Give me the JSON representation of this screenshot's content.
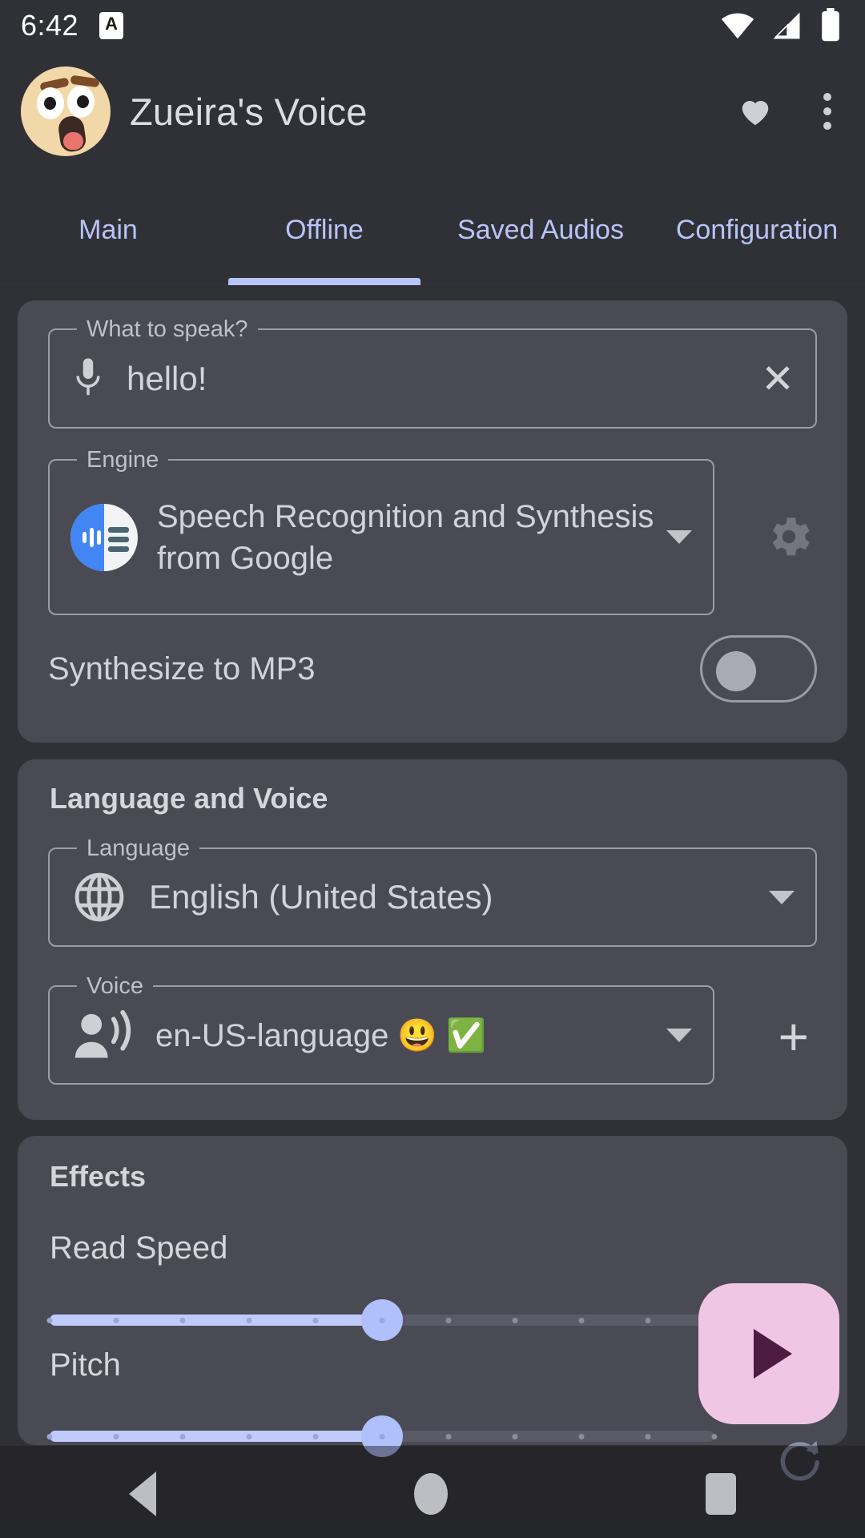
{
  "status_bar": {
    "time": "6:42",
    "app_badge": "A",
    "icons": [
      "wifi-icon",
      "cell-signal-icon",
      "battery-icon"
    ]
  },
  "app_bar": {
    "title": "Zueira's Voice",
    "avatar_icon": "shocked-face-emoji-avatar",
    "favorite_icon": "heart-icon",
    "overflow_icon": "kebab-menu-icon"
  },
  "tabs": {
    "items": [
      {
        "label": "Main",
        "active": false
      },
      {
        "label": "Offline",
        "active": true
      },
      {
        "label": "Saved Audios",
        "active": false
      },
      {
        "label": "Configuration",
        "active": false
      }
    ]
  },
  "speak_card": {
    "text_field": {
      "legend": "What to speak?",
      "value": "hello!",
      "placeholder": "What to speak?",
      "leading_icon": "microphone-icon",
      "clear_label": "✕"
    },
    "engine": {
      "legend": "Engine",
      "value": "Speech Recognition and Synthesis from Google",
      "leading_icon": "google-tts-icon",
      "dropdown_icon": "chevron-down-icon",
      "settings_icon": "gear-icon"
    },
    "mp3_toggle": {
      "label": "Synthesize to MP3",
      "state": "off"
    }
  },
  "language_voice_card": {
    "title": "Language and Voice",
    "language": {
      "legend": "Language",
      "value": "English (United States)",
      "leading_icon": "globe-icon",
      "dropdown_icon": "chevron-down-icon"
    },
    "voice": {
      "legend": "Voice",
      "value": "en-US-language 😃 ✅",
      "leading_icon": "person-speaking-icon",
      "dropdown_icon": "chevron-down-icon",
      "add_label": "+"
    }
  },
  "effects_card": {
    "title": "Effects",
    "read_speed": {
      "label": "Read Speed",
      "value_percent": 50,
      "ticks": 11
    },
    "pitch": {
      "label": "Pitch",
      "value_percent": 50,
      "ticks": 11
    }
  },
  "fab": {
    "action": "play",
    "icon": "play-triangle-icon",
    "background": "#EFC6E3",
    "icon_color": "#4E1B42"
  },
  "reset_button": {
    "icon": "refresh-icon"
  },
  "nav_bar": {
    "back_icon": "back-triangle-icon",
    "home_icon": "home-circle-icon",
    "recents_icon": "recents-square-icon"
  },
  "colors": {
    "page_background": "#303136",
    "card_background": "#494A54",
    "accent": "#B8C4F7",
    "text_primary": "#D2D3DA",
    "text_secondary": "#BFC0C8",
    "fab": "#EFC6E3"
  }
}
